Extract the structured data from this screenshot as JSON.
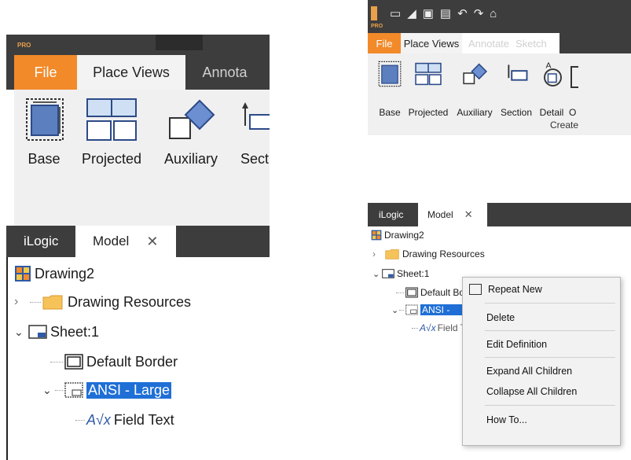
{
  "left": {
    "qat_label": "PRO",
    "tabs": {
      "file": "File",
      "place_views": "Place Views",
      "annotate": "Annota"
    },
    "ribbon": {
      "base": "Base",
      "projected": "Projected",
      "auxiliary": "Auxiliary",
      "section": "Secti"
    },
    "panel_tabs": {
      "ilogic": "iLogic",
      "model": "Model"
    },
    "tree": {
      "drawing": "Drawing2",
      "resources": "Drawing Resources",
      "sheet": "Sheet:1",
      "border": "Default Border",
      "ansi": "ANSI - Large",
      "field": "Field Text"
    }
  },
  "right": {
    "qat_label": "PRO",
    "tabs": {
      "file": "File",
      "place_views": "Place Views",
      "annotate": "Annotate",
      "sketch": "Sketch"
    },
    "ribbon": {
      "base": "Base",
      "projected": "Projected",
      "auxiliary": "Auxiliary",
      "section": "Section",
      "detail": "Detail",
      "more": "O",
      "group": "Create"
    },
    "panel_tabs": {
      "ilogic": "iLogic",
      "model": "Model"
    },
    "tree": {
      "drawing": "Drawing2",
      "resources": "Drawing Resources",
      "sheet": "Sheet:1",
      "border": "Default Border",
      "ansi": "ANSI - ",
      "field": "Field Text"
    },
    "context_menu": {
      "repeat": "Repeat New",
      "delete": "Delete",
      "edit": "Edit Definition",
      "expand": "Expand All Children",
      "collapse": "Collapse All Children",
      "howto": "How To..."
    }
  },
  "colors": {
    "file_tab": "#f28a2a",
    "titlebar": "#3d3d3d",
    "selection": "#1f6fd6"
  }
}
